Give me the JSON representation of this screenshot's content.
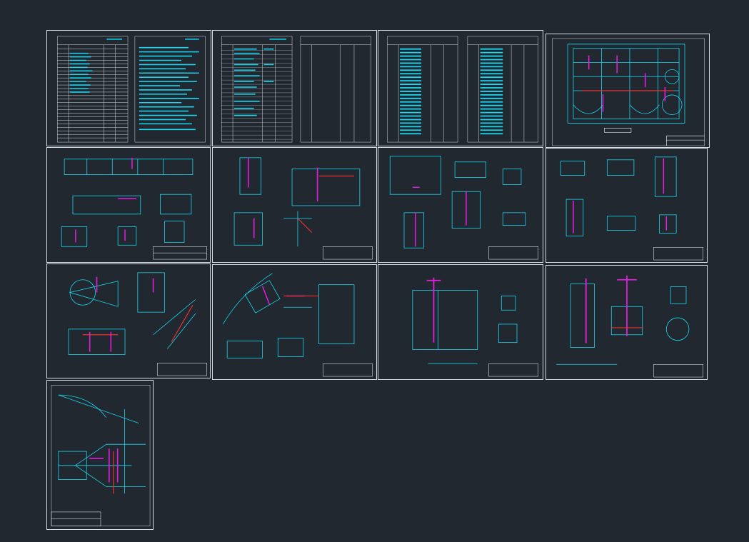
{
  "app": {
    "title": ""
  },
  "colors": {
    "background": "#212830",
    "frame": "#d8dde2",
    "cyan": "#19d7f0",
    "magenta": "#e41ee0",
    "red": "#e83232",
    "white": "#ffffff"
  },
  "sheets": [
    {
      "id": "s1",
      "kind": "tables"
    },
    {
      "id": "s2",
      "kind": "tables"
    },
    {
      "id": "s3",
      "kind": "tables"
    },
    {
      "id": "s4",
      "kind": "plan"
    },
    {
      "id": "s5",
      "kind": "sections"
    },
    {
      "id": "s6",
      "kind": "details"
    },
    {
      "id": "s7",
      "kind": "details"
    },
    {
      "id": "s8",
      "kind": "details"
    },
    {
      "id": "s9",
      "kind": "details"
    },
    {
      "id": "s10",
      "kind": "details"
    },
    {
      "id": "s11",
      "kind": "details"
    },
    {
      "id": "s12",
      "kind": "details"
    },
    {
      "id": "s13",
      "kind": "plan"
    }
  ]
}
